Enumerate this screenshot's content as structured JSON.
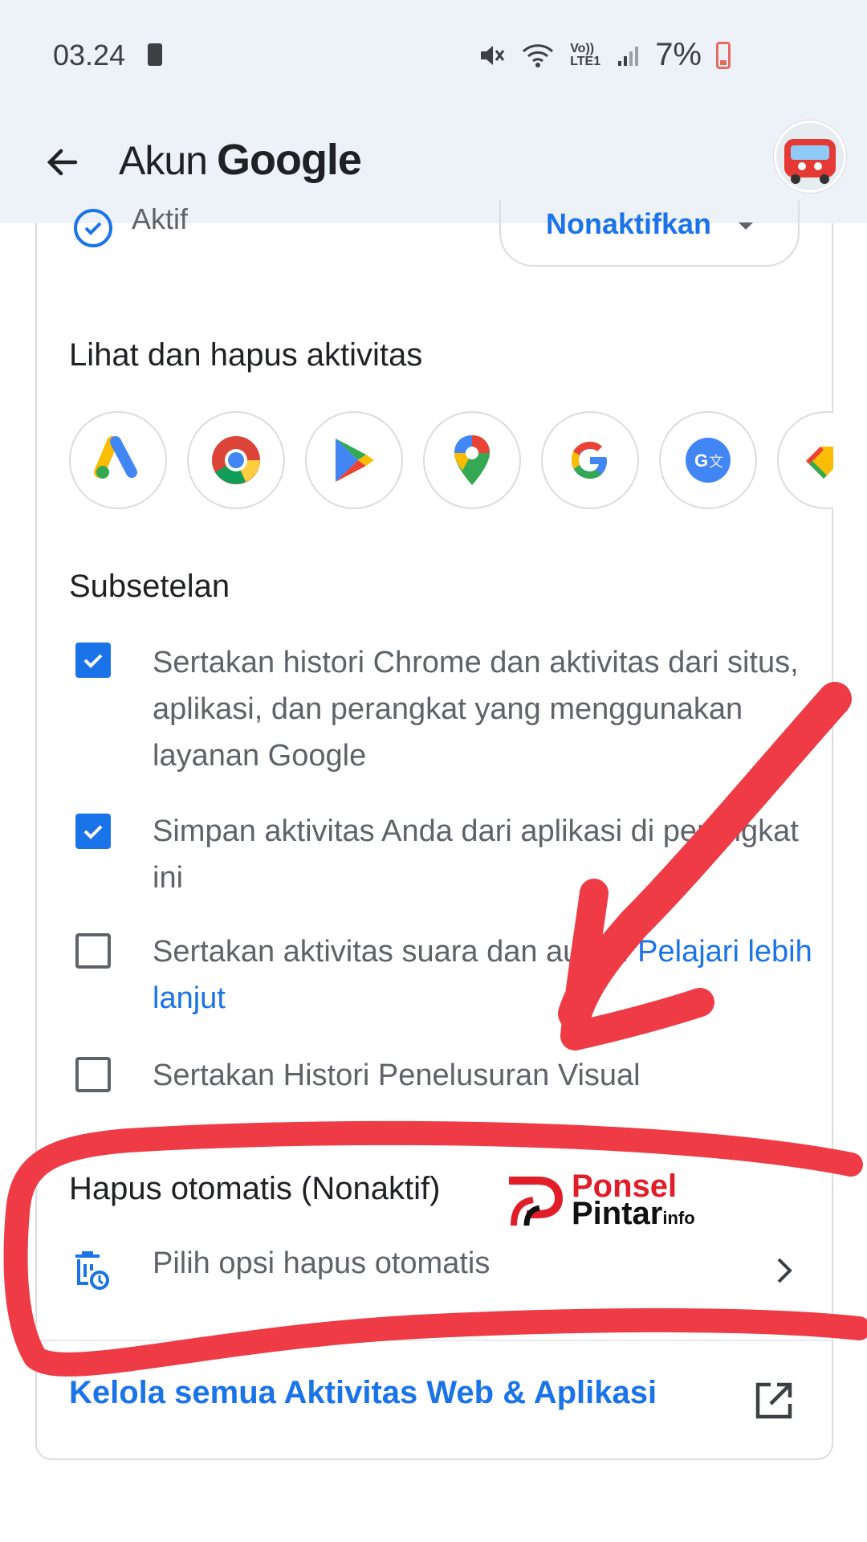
{
  "status_bar": {
    "time": "03.24",
    "network_label": "Vo)) LTE1",
    "battery_percent": "7%"
  },
  "app_bar": {
    "title_prefix": "Akun",
    "title_brand": "Google"
  },
  "activity": {
    "status_label": "Aktif",
    "toggle_label": "Nonaktifkan"
  },
  "view_delete": {
    "title": "Lihat dan hapus aktivitas",
    "apps": [
      "google-ads-icon",
      "chrome-icon",
      "play-store-icon",
      "maps-icon",
      "google-search-icon",
      "google-translate-icon",
      "google-shopping-icon"
    ]
  },
  "subsettings": {
    "title": "Subsetelan",
    "items": [
      {
        "text": "Sertakan histori Chrome dan aktivitas dari situs, aplikasi, dan perangkat yang menggunakan layanan Google",
        "checked": true
      },
      {
        "text": "Simpan aktivitas Anda dari aplikasi di perangkat ini",
        "checked": true
      },
      {
        "text": "Sertakan aktivitas suara dan audio.",
        "link": "Pelajari lebih lanjut",
        "checked": false
      },
      {
        "text": "Sertakan Histori Penelusuran Visual",
        "checked": false
      }
    ]
  },
  "auto_delete": {
    "title": "Hapus otomatis (Nonaktif)",
    "option_label": "Pilih opsi hapus otomatis"
  },
  "manage": {
    "label": "Kelola semua Aktivitas Web & Aplikasi"
  },
  "watermark": {
    "line1": "Ponsel",
    "line2": "Pintar",
    "suffix": "info"
  },
  "colors": {
    "accent": "#1a73e8",
    "annotation_red": "#ee3b45",
    "header_bg": "#edf1f8"
  }
}
